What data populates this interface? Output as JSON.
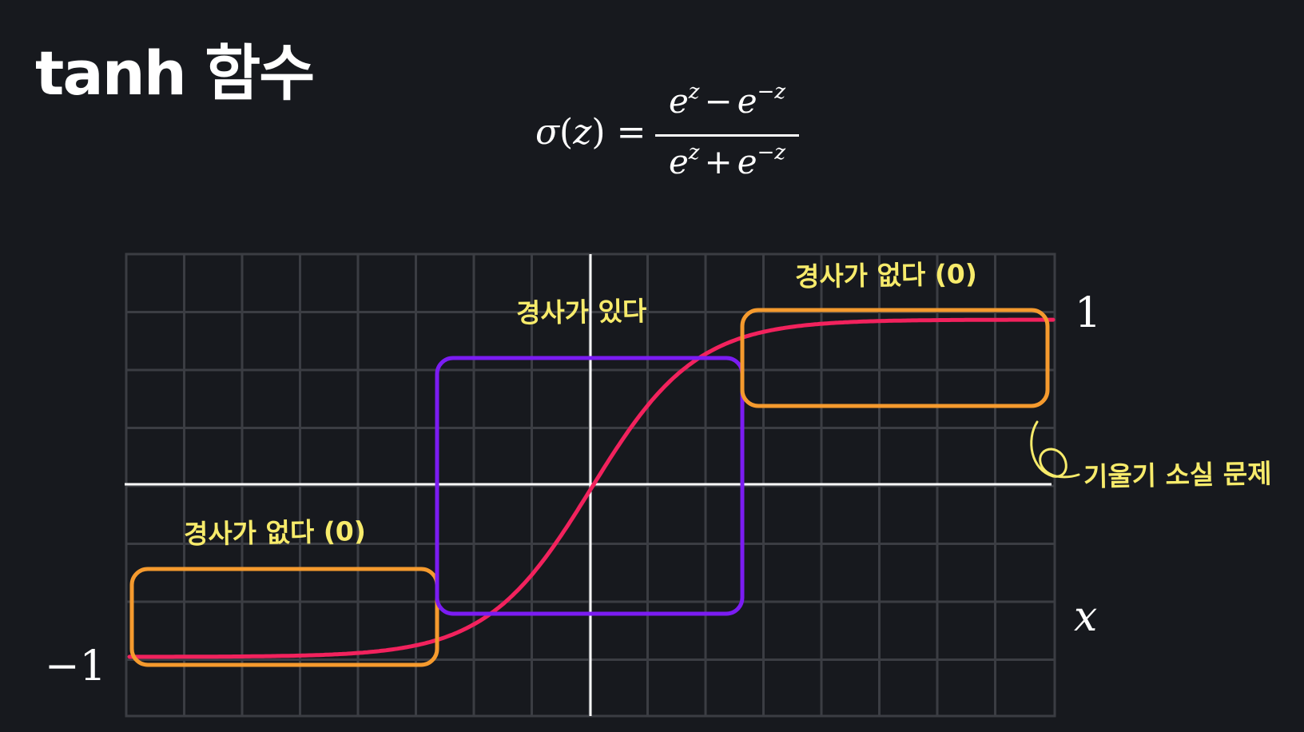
{
  "slide": {
    "title": "tanh 함수"
  },
  "formula": {
    "lhs_symbol": "σ",
    "lhs_paren_open": "(",
    "lhs_var": "z",
    "lhs_paren_close": ")",
    "equals": "=",
    "numerator": {
      "base1": "e",
      "exp1": "z",
      "op": "−",
      "base2": "e",
      "exp2": "−z"
    },
    "denominator": {
      "base1": "e",
      "exp1": "z",
      "op": "+",
      "base2": "e",
      "exp2": "−z"
    }
  },
  "graph": {
    "label_one": "1",
    "label_x": "x",
    "label_neg_one": "−1"
  },
  "annotations": {
    "no_slope_top": "경사가 없다 (0)",
    "has_slope": "경사가 있다",
    "no_slope_left": "경사가 없다 (0)",
    "vanishing_gradient": "기울기 소실 문제"
  },
  "colors": {
    "background": "#17191e",
    "grid": "#3b3d43",
    "axes": "#ffffff",
    "curve": "#f2225d",
    "flat_region_box": "#f59a2e",
    "slope_region_box": "#7b1cf2",
    "annotation_text": "#f7eb6b"
  },
  "chart_data": {
    "type": "line",
    "function": "tanh",
    "xlim": [
      -8,
      8
    ],
    "ylim": [
      -1,
      1
    ],
    "grid": true
  }
}
